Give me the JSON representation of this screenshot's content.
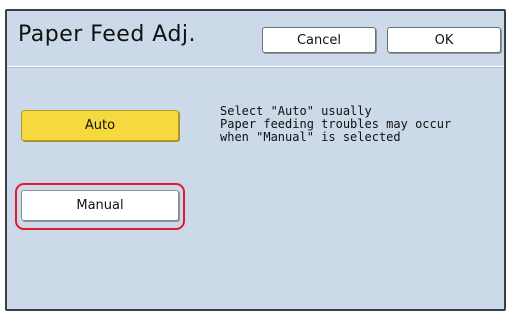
{
  "header": {
    "title": "Paper Feed Adj.",
    "cancel_label": "Cancel",
    "ok_label": "OK"
  },
  "options": {
    "auto_label": "Auto",
    "manual_label": "Manual",
    "selected": "Auto",
    "highlighted": "Manual"
  },
  "message": {
    "lines": [
      "Select \"Auto\" usually",
      "Paper feeding troubles may occur",
      "when \"Manual\" is selected"
    ]
  },
  "colors": {
    "panel_background": "#ccd9e8",
    "selected_button": "#f5d93f",
    "highlight_ring": "#e21b2c"
  }
}
